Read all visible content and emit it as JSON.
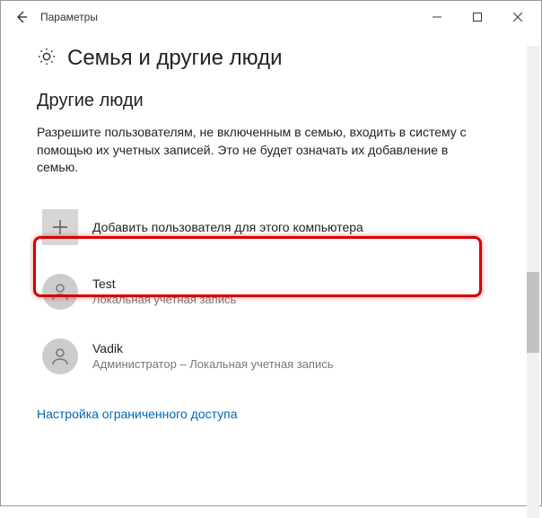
{
  "titlebar": {
    "title": "Параметры"
  },
  "page": {
    "title": "Семья и другие люди"
  },
  "section": {
    "title": "Другие люди",
    "description": "Разрешите пользователям, не включенным в семью, входить в систему с помощью их учетных записей. Это не будет означать их добавление в семью.",
    "add_user_label": "Добавить пользователя для этого компьютера"
  },
  "users": [
    {
      "name": "Test",
      "subtitle": "Локальная учетная запись"
    },
    {
      "name": "Vadik",
      "subtitle": "Администратор – Локальная учетная запись"
    }
  ],
  "links": {
    "restricted_access": "Настройка ограниченного доступа"
  }
}
